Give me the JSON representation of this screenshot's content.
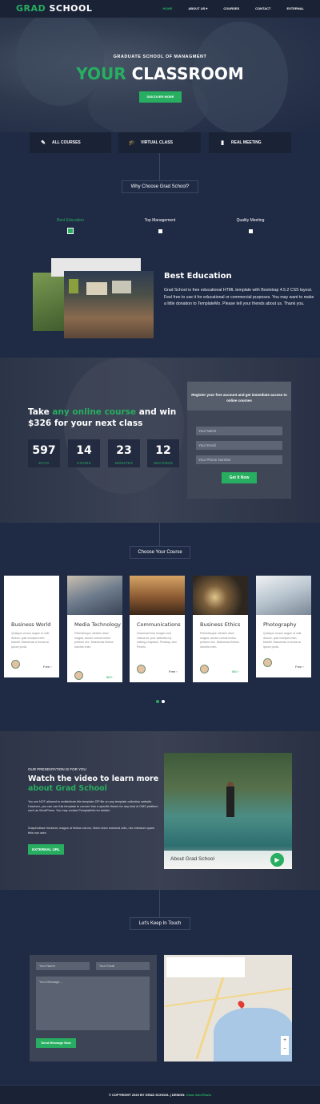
{
  "header": {
    "logo": "GRAD SCHOOL",
    "nav": [
      "HOME",
      "ABOUT US ▾",
      "COURSES",
      "CONTACT",
      "EXTERNAL"
    ]
  },
  "hero": {
    "subtitle": "GRADUATE SCHOOL OF MANAGMENT",
    "title_highlight": "YOUR",
    "title_rest": " CLASSROOM",
    "button": "DISCOVER MORE"
  },
  "features": [
    {
      "icon": "pencil-icon",
      "label": "ALL COURSES"
    },
    {
      "icon": "graduation-cap-icon",
      "label": "VIRTUAL CLASS"
    },
    {
      "icon": "book-icon",
      "label": "REAL MEETING"
    }
  ],
  "why": {
    "heading": "Why Choose Grad School?",
    "tabs": [
      "Best Education",
      "Top Management",
      "Quality Meeting"
    ],
    "active_tab": 0
  },
  "education": {
    "title": "Best Education",
    "text": "Grad School is free educational HTML template with Bootstrap 4.5.2 CSS layout. Feel free to use it for educational or commercial purposes. You may want to make a little donation to TemplateMo. Please tell your friends about us. Thank you."
  },
  "offer": {
    "title_pre": "Take ",
    "title_highlight": "any online course",
    "title_post": " and win $326 for your next class",
    "countdown": [
      {
        "value": "597",
        "label": "DAYS"
      },
      {
        "value": "14",
        "label": "HOURS"
      },
      {
        "value": "23",
        "label": "MINUTES"
      },
      {
        "value": "12",
        "label": "SECONDS"
      }
    ],
    "register_heading": "Register your free account and get immediate access to online courses",
    "fields": [
      "Your Name",
      "Your Email",
      "Your Phone Number"
    ],
    "button": "Get It Now"
  },
  "courses": {
    "heading": "Choose Your Course",
    "items": [
      {
        "title": "Business World",
        "text": "Quisque cursus augue ut velit dictum, quis volutpat enim blandit. Maecenas a lectus ac ipsum porta.",
        "price": "Free",
        "price_is_green": false
      },
      {
        "title": "Media Technology",
        "text": "Pellentesque ultricies diam magna, auctor cursus lectus pretium nec. Maecenas finibus lobortis enim.",
        "price": "$60",
        "price_is_green": true
      },
      {
        "title": "Communications",
        "text": "Download free images and videos for your websites by visiting Unsplash, Pixabay, and Pexels.",
        "price": "Free",
        "price_is_green": false
      },
      {
        "title": "Business Ethics",
        "text": "Pellentesque ultricies diam magna, auctor cursus lectus pretium nec. Maecenas finibus lobortis enim.",
        "price": "$60",
        "price_is_green": true
      },
      {
        "title": "Photography",
        "text": "Quisque cursus augue ut velit dictum, quis volutpat enim blandit. Maecenas a lectus ac ipsum porta.",
        "price": "Free",
        "price_is_green": false
      }
    ]
  },
  "video": {
    "small": "OUR PRESENTATION IS FOR YOU",
    "title_pre": "Watch the video to learn more ",
    "title_highlight": "about Grad School",
    "text1": "You are NOT allowed to redistribute this template ZIP file on any template collection website. However, you can use this template to convert into a specific theme for any kind of CMS platform such as WordPress. You may contact TemplateMo for details.",
    "text2": "Suspendisse tincidunt, magna ut finibus rutrum, libero dolor euismod odio, nec interdum quam felis non ante.",
    "button": "EXTERNAL URL",
    "caption": "About Grad School"
  },
  "contact": {
    "heading": "Let's Keep In Touch",
    "name_placeholder": "Your Name",
    "email_placeholder": "Your Email",
    "message_placeholder": "Your Message...",
    "button": "Send Message Now"
  },
  "footer": {
    "copyright": "© COPYRIGHT 2020 BY GRAD SCHOOL | DESIGN: ",
    "designer": "Omar Abd Elaziz"
  },
  "colors": {
    "accent": "#27ae60",
    "background": "#1f2a44",
    "header": "#1a2236"
  }
}
